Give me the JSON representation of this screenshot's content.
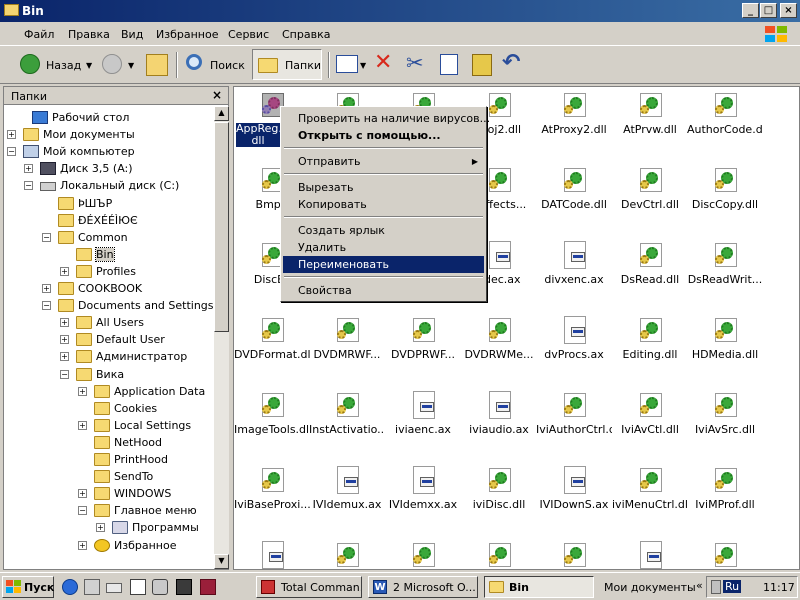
{
  "window": {
    "title": "Bin"
  },
  "menubar": {
    "items": [
      "Файл",
      "Правка",
      "Вид",
      "Избранное",
      "Сервис",
      "Справка"
    ]
  },
  "toolbar": {
    "back": "Назад",
    "search": "Поиск",
    "folders": "Папки"
  },
  "folders_pane": {
    "title": "Папки",
    "tree": [
      {
        "label": "Рабочий стол",
        "icon": "desktop-icon",
        "expander": ""
      },
      {
        "label": "Мои документы",
        "icon": "folder-icon",
        "expander": "+"
      },
      {
        "label": "Мой компьютер",
        "icon": "computer-icon",
        "expander": "-"
      },
      {
        "label": "Диск 3,5 (A:)",
        "icon": "floppy-icon",
        "expander": "+"
      },
      {
        "label": "Локальный диск (C:)",
        "icon": "drive-icon",
        "expander": "-"
      },
      {
        "label": "ÞШЪР",
        "icon": "folder-icon",
        "expander": ""
      },
      {
        "label": "ÐÉXÉÉÌЮЄ",
        "icon": "folder-icon",
        "expander": ""
      },
      {
        "label": "Common",
        "icon": "folder-icon",
        "expander": "-"
      },
      {
        "label": "Bin",
        "icon": "folder-open-icon",
        "expander": ""
      },
      {
        "label": "Profiles",
        "icon": "folder-icon",
        "expander": "+"
      },
      {
        "label": "COOKBOOK",
        "icon": "folder-icon",
        "expander": "+"
      },
      {
        "label": "Documents and Settings",
        "icon": "folder-icon",
        "expander": "-"
      },
      {
        "label": "All Users",
        "icon": "folder-icon",
        "expander": "+"
      },
      {
        "label": "Default User",
        "icon": "folder-icon",
        "expander": "+"
      },
      {
        "label": "Администратор",
        "icon": "folder-icon",
        "expander": "+"
      },
      {
        "label": "Вика",
        "icon": "folder-icon",
        "expander": "-"
      },
      {
        "label": "Application Data",
        "icon": "folder-icon",
        "expander": "+"
      },
      {
        "label": "Cookies",
        "icon": "folder-icon",
        "expander": ""
      },
      {
        "label": "Local Settings",
        "icon": "folder-icon",
        "expander": "+"
      },
      {
        "label": "NetHood",
        "icon": "folder-icon",
        "expander": ""
      },
      {
        "label": "PrintHood",
        "icon": "folder-icon",
        "expander": ""
      },
      {
        "label": "SendTo",
        "icon": "folder-icon",
        "expander": ""
      },
      {
        "label": "WINDOWS",
        "icon": "folder-icon",
        "expander": "+"
      },
      {
        "label": "Главное меню",
        "icon": "folder-icon",
        "expander": "-"
      },
      {
        "label": "Программы",
        "icon": "programs-icon",
        "expander": "+"
      },
      {
        "label": "Избранное",
        "icon": "favorites-icon",
        "expander": "+"
      }
    ]
  },
  "files": [
    {
      "name": "AppReg... dll",
      "type": "dll",
      "selected": true
    },
    {
      "name": "",
      "type": "dll"
    },
    {
      "name": "",
      "type": "dll"
    },
    {
      "name": "Proj2.dll",
      "type": "dll"
    },
    {
      "name": "AtProxy2.dll",
      "type": "dll"
    },
    {
      "name": "AtPrvw.dll",
      "type": "dll"
    },
    {
      "name": "AuthorCode.dll",
      "type": "dll"
    },
    {
      "name": "BmpR",
      "type": "dll"
    },
    {
      "name": "",
      "type": "dll"
    },
    {
      "name": "",
      "type": "dll"
    },
    {
      "name": "aEffects...",
      "type": "dll"
    },
    {
      "name": "DATCode.dll",
      "type": "dll"
    },
    {
      "name": "DevCtrl.dll",
      "type": "dll"
    },
    {
      "name": "DiscCopy.dll",
      "type": "dll"
    },
    {
      "name": "DiscEc",
      "type": "dll"
    },
    {
      "name": "",
      "type": "dll"
    },
    {
      "name": "",
      "type": "dll"
    },
    {
      "name": "xdec.ax",
      "type": "ax"
    },
    {
      "name": "divxenc.ax",
      "type": "ax"
    },
    {
      "name": "DsRead.dll",
      "type": "dll"
    },
    {
      "name": "DsReadWrit...",
      "type": "dll"
    },
    {
      "name": "DVDFormat.dll",
      "type": "dll"
    },
    {
      "name": "DVDMRWF...",
      "type": "dll"
    },
    {
      "name": "DVDPRWF...",
      "type": "dll"
    },
    {
      "name": "DVDRWMe...",
      "type": "dll"
    },
    {
      "name": "dvProcs.ax",
      "type": "ax"
    },
    {
      "name": "Editing.dll",
      "type": "dll"
    },
    {
      "name": "HDMedia.dll",
      "type": "dll"
    },
    {
      "name": "ImageTools.dll",
      "type": "dll"
    },
    {
      "name": "InstActivatio...",
      "type": "dll"
    },
    {
      "name": "iviaenc.ax",
      "type": "ax"
    },
    {
      "name": "iviaudio.ax",
      "type": "ax"
    },
    {
      "name": "IviAuthorCtrl.dll",
      "type": "dll"
    },
    {
      "name": "IviAvCtl.dll",
      "type": "dll"
    },
    {
      "name": "IviAvSrc.dll",
      "type": "dll"
    },
    {
      "name": "IviBaseProxi...",
      "type": "dll"
    },
    {
      "name": "IVIdemux.ax",
      "type": "ax"
    },
    {
      "name": "IVIdemxx.ax",
      "type": "ax"
    },
    {
      "name": "iviDisc.dll",
      "type": "dll"
    },
    {
      "name": "IVIDownS.ax",
      "type": "ax"
    },
    {
      "name": "iviMenuCtrl.dll",
      "type": "dll"
    },
    {
      "name": "IviMProf.dll",
      "type": "dll"
    },
    {
      "name": "",
      "type": "ax"
    },
    {
      "name": "",
      "type": "dll"
    },
    {
      "name": "",
      "type": "dll"
    },
    {
      "name": "",
      "type": "dll"
    },
    {
      "name": "",
      "type": "dll"
    },
    {
      "name": "",
      "type": "ax"
    },
    {
      "name": "",
      "type": "dll"
    }
  ],
  "context_menu": {
    "items": [
      {
        "label": "Проверить на наличие вирусов...",
        "bold": false
      },
      {
        "label": "Открыть с помощью...",
        "bold": true
      },
      {
        "sep": true
      },
      {
        "label": "Отправить",
        "submenu": true
      },
      {
        "sep": true
      },
      {
        "label": "Вырезать"
      },
      {
        "label": "Копировать"
      },
      {
        "sep": true
      },
      {
        "label": "Создать ярлык"
      },
      {
        "label": "Удалить"
      },
      {
        "label": "Переименовать",
        "highlighted": true
      },
      {
        "sep": true
      },
      {
        "label": "Свойства"
      }
    ]
  },
  "taskbar": {
    "start": "Пуск",
    "tasks": [
      "Total Comman...",
      "2 Microsoft O...",
      "Bin"
    ],
    "active_task": "Bin",
    "docs_label": "Мои документы",
    "lang": "Ru",
    "clock": "11:17"
  },
  "colors": {
    "selection": "#0a246a",
    "face": "#d4d0c8",
    "title_start": "#0a246a",
    "title_end": "#3a6ea5"
  }
}
